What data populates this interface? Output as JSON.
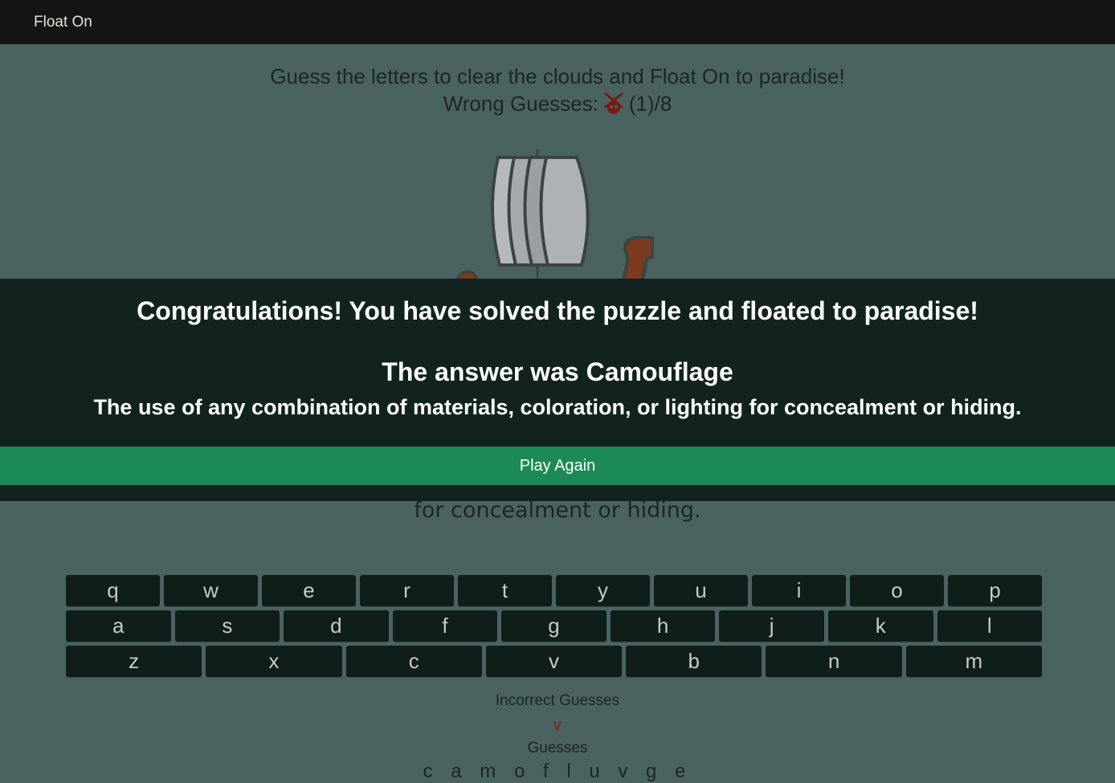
{
  "app": {
    "title": "Float On"
  },
  "header": {
    "instruction": "Guess the letters to clear the clouds and Float On to paradise!",
    "wrong_label": "Wrong Guesses:",
    "wrong_count": "(1)/8",
    "wrong_icon": "skull-icon"
  },
  "result": {
    "congrats": "Congratulations! You have solved the puzzle and floated to paradise!",
    "answer": "The answer was Camouflage",
    "definition": "The use of any combination of materials, coloration, or lighting for concealment or hiding.",
    "play_again": "Play Again"
  },
  "clue_tail": "for concealment or hiding.",
  "keyboard": {
    "row1": [
      "q",
      "w",
      "e",
      "r",
      "t",
      "y",
      "u",
      "i",
      "o",
      "p"
    ],
    "row2": [
      "a",
      "s",
      "d",
      "f",
      "g",
      "h",
      "j",
      "k",
      "l"
    ],
    "row3": [
      "z",
      "x",
      "c",
      "v",
      "b",
      "n",
      "m"
    ]
  },
  "incorrect": {
    "label": "Incorrect Guesses",
    "letters": "v"
  },
  "guesses": {
    "label": "Guesses",
    "letters": "c a m o f l u v g e"
  },
  "colors": {
    "background": "#4a6361",
    "topbar": "#161412",
    "overlay": "#12231f",
    "play_again": "#1b8a56",
    "key": "#0f1d1b",
    "incorrect_letter": "#8a1d12"
  }
}
